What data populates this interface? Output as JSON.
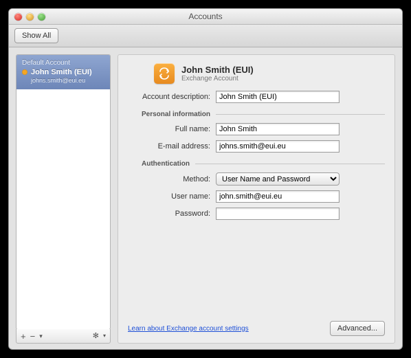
{
  "window": {
    "title": "Accounts"
  },
  "toolbar": {
    "show_all": "Show All"
  },
  "sidebar": {
    "header": "Default Account",
    "selected": {
      "name": "John Smith (EUI)",
      "email": "johns.smith@eui.eu"
    },
    "footer": {
      "add": "+",
      "remove": "−",
      "menu": "▾",
      "gear": "✻"
    }
  },
  "account": {
    "icon_letter": "✕",
    "title": "John Smith (EUI)",
    "subtitle": "Exchange Account"
  },
  "labels": {
    "account_description": "Account description:",
    "personal_info": "Personal information",
    "full_name": "Full name:",
    "email": "E-mail address:",
    "authentication": "Authentication",
    "method": "Method:",
    "user_name": "User name:",
    "password": "Password:"
  },
  "values": {
    "account_description": "John Smith (EUI)",
    "full_name": "John Smith",
    "email": "johns.smith@eui.eu",
    "method": "User Name and Password",
    "user_name": "john.smith@eui.eu",
    "password": ""
  },
  "footer": {
    "learn_link": "Learn about Exchange account settings",
    "advanced": "Advanced..."
  }
}
